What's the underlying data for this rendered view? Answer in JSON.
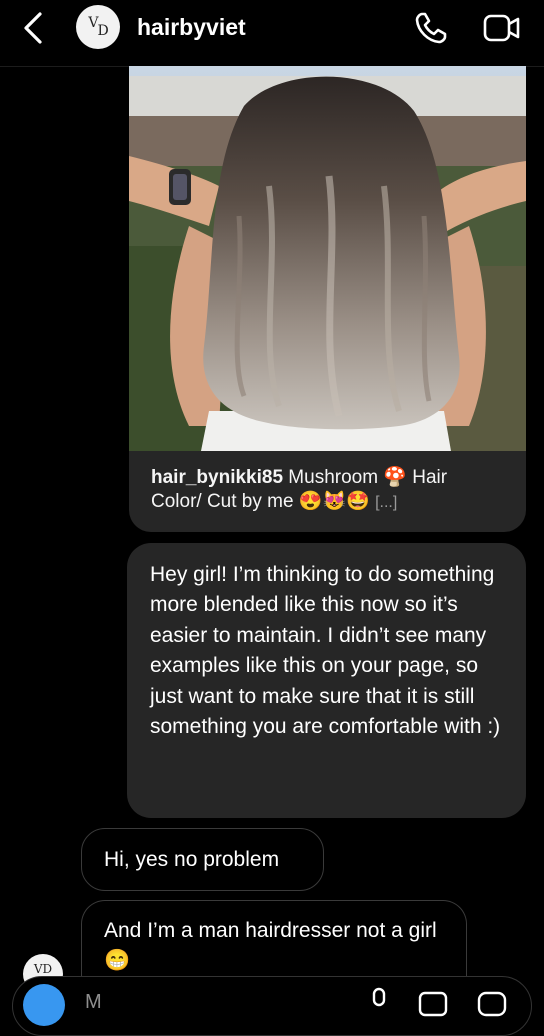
{
  "header": {
    "avatar_initials_top": "V",
    "avatar_initials_bottom": "D",
    "username": "hairbyviet"
  },
  "shared_post": {
    "author": "hair_bynikki85",
    "caption_line1": " Mushroom 🍄  Hair",
    "caption_line2": "Color/ Cut by me 😍😻🤩 ",
    "more": "[...]"
  },
  "messages": [
    {
      "from": "me",
      "text": "Hey girl! I’m thinking to do something more blended like this now so it’s easier to maintain. I didn’t see many examples like this on your page, so just want to make sure that it is still something you are comfortable with :)"
    },
    {
      "from": "them",
      "text": "Hi, yes no problem"
    },
    {
      "from": "them",
      "text": "And I’m a man hairdresser not a girl 😁"
    }
  ],
  "small_avatar_initials": "VD",
  "composer": {
    "placeholder": "M"
  },
  "colors": {
    "background": "#000000",
    "bubble": "#262626",
    "bubble_border": "#3a3a3a",
    "camera_button": "#3897f0"
  }
}
